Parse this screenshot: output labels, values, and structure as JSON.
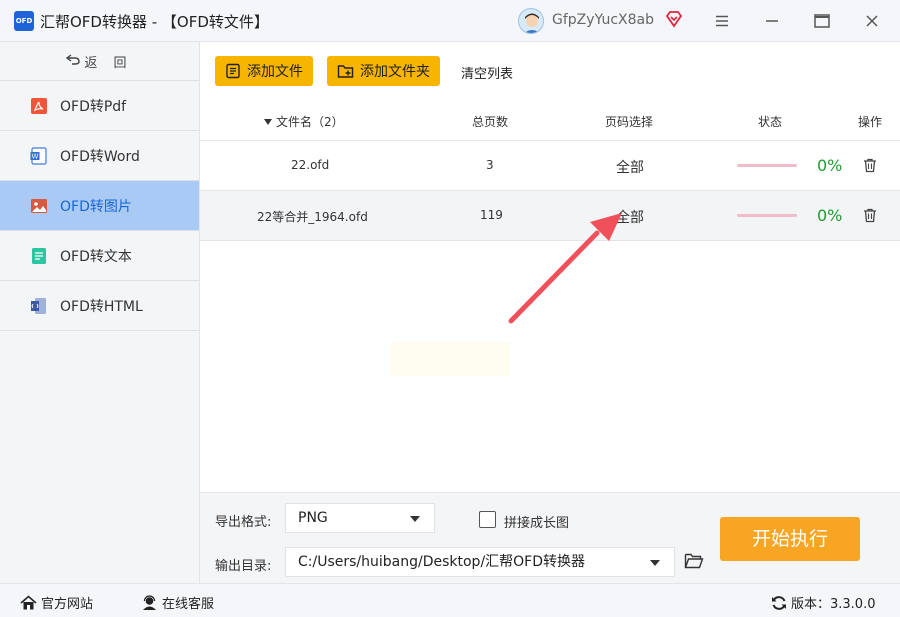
{
  "window": {
    "logo_text": "OFD",
    "title": "汇帮OFD转换器 - 【OFD转文件】",
    "user_name": "GfpZyYucX8ab"
  },
  "sidebar": {
    "back_label": "返 回",
    "items": [
      {
        "label": "OFD转Pdf",
        "icon": "pdf-icon",
        "active": false
      },
      {
        "label": "OFD转Word",
        "icon": "word-icon",
        "active": false
      },
      {
        "label": "OFD转图片",
        "icon": "image-icon",
        "active": true
      },
      {
        "label": "OFD转文本",
        "icon": "text-icon",
        "active": false
      },
      {
        "label": "OFD转HTML",
        "icon": "html-icon",
        "active": false
      }
    ]
  },
  "toolbar": {
    "add_file": "添加文件",
    "add_folder": "添加文件夹",
    "clear_list": "清空列表"
  },
  "table": {
    "headers": {
      "filename": "文件名（2）",
      "pages": "总页数",
      "page_select": "页码选择",
      "status": "状态",
      "action": "操作"
    },
    "rows": [
      {
        "filename": "22.ofd",
        "pages": "3",
        "page_select": "全部",
        "progress": "0%"
      },
      {
        "filename": "22等合并_1964.ofd",
        "pages": "119",
        "page_select": "全部",
        "progress": "0%"
      }
    ]
  },
  "bottom": {
    "format_label": "导出格式:",
    "format_value": "PNG",
    "merge_label": "拼接成长图",
    "output_label": "输出目录:",
    "output_value": "C:/Users/huibang/Desktop/汇帮OFD转换器",
    "start_label": "开始执行"
  },
  "statusbar": {
    "website": "官方网站",
    "service": "在线客服",
    "version": "版本：3.3.0.0"
  },
  "colors": {
    "accent_yellow": "#f7b500",
    "start_orange": "#f8a523",
    "active_nav": "#a9caf4",
    "progress_green": "#1e9c2f",
    "arrow_red": "#f0505a"
  }
}
